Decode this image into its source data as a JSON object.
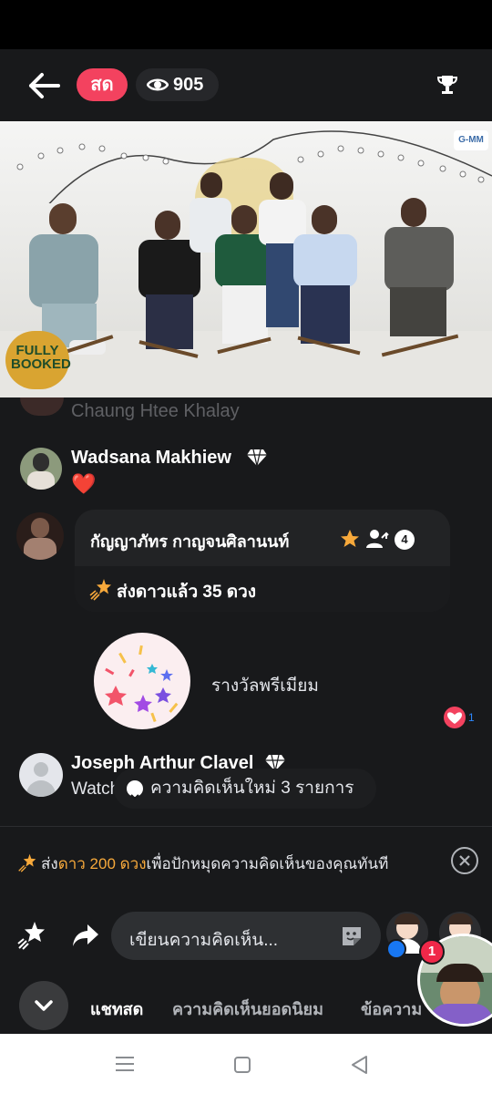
{
  "header": {
    "live_label": "สด",
    "viewer_count": "905"
  },
  "video": {
    "show_logo_text": "FULLY BOOKED",
    "network_logo_text": "G-MM"
  },
  "comments": [
    {
      "name": "Chaung Htee Khalay"
    },
    {
      "name": "Wadsana Makhiew",
      "text": "❤️"
    },
    {
      "name": "Joseph Arthur Clavel",
      "text": "Watch"
    }
  ],
  "stars_card": {
    "name": "กัญญาภัทร กาญจนศิลานนท์",
    "badge_count": "4",
    "sent_text": "ส่งดาวแล้ว 35 ดวง"
  },
  "premium": {
    "label": "รางวัลพรีเมียม"
  },
  "reactions": {
    "heart_count": "1"
  },
  "new_comments_pill": "ความคิดเห็นใหม่ 3 รายการ",
  "pin_bar": {
    "prefix": "ส่ง",
    "highlight": "ดาว 200 ดวง",
    "suffix": "เพื่อปักหมุดความคิดเห็นของคุณทันที"
  },
  "composer": {
    "placeholder": "เขียนความคิดเห็น..."
  },
  "tabs": [
    {
      "label": "แชทสด"
    },
    {
      "label": "ความคิดเห็นยอดนิยม"
    },
    {
      "label": "ข้อความ"
    }
  ],
  "bubble_badge": "1",
  "colors": {
    "live_red": "#f3425f",
    "star_orange": "#f7a93b",
    "background": "#18191b"
  }
}
